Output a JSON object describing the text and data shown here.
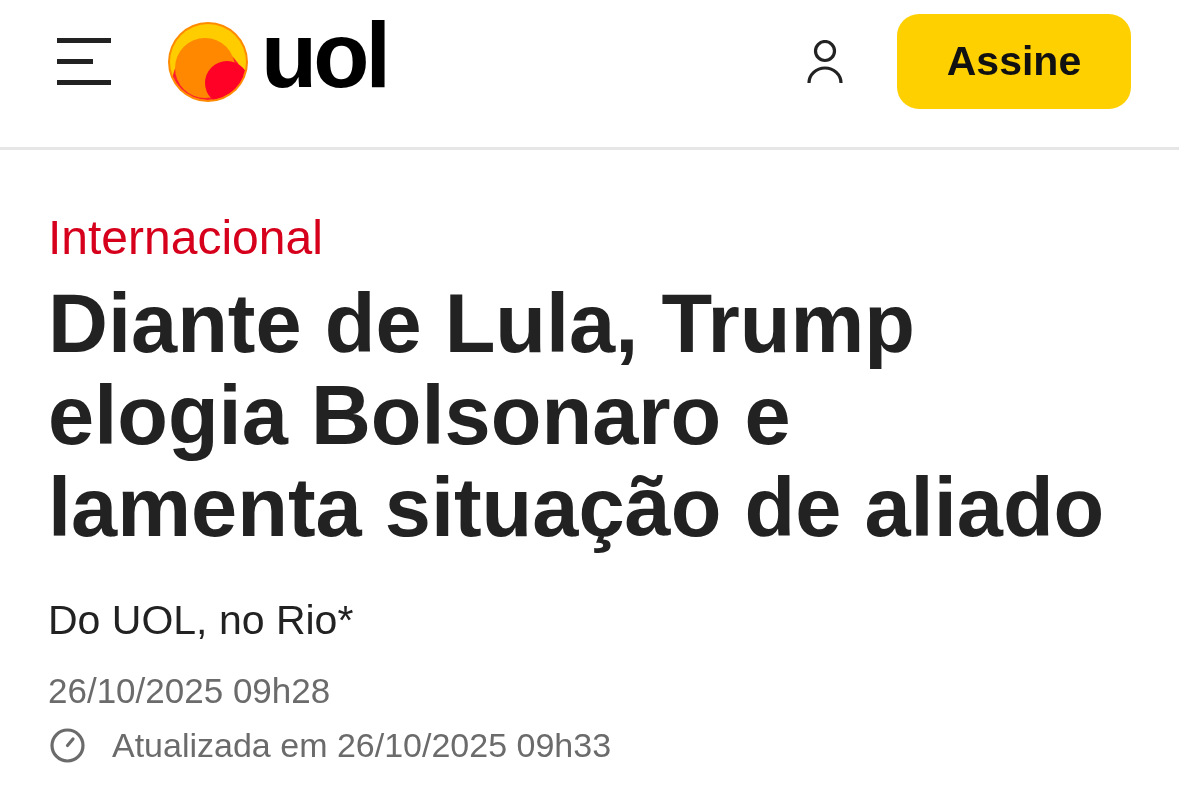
{
  "header": {
    "logo_text": "uol",
    "subscribe_button": "Assine"
  },
  "article": {
    "section": "Internacional",
    "headline": "Diante de Lula, Trump elogia Bolsonaro e lamenta situação de aliado",
    "byline": "Do UOL, no Rio*",
    "published": "26/10/2025 09h28",
    "updated": "Atualizada em 26/10/2025 09h33"
  }
}
